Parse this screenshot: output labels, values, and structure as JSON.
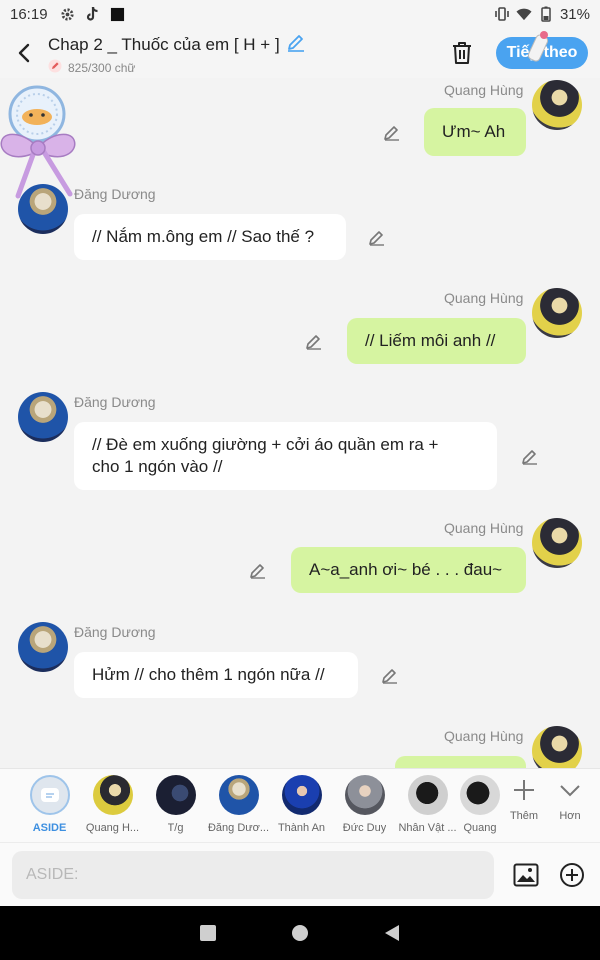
{
  "status_bar": {
    "time": "16:19",
    "battery": "31%",
    "left_icons": [
      "gear-icon",
      "tiktok-icon",
      "square-icon"
    ],
    "right_icons": [
      "vibrate-icon",
      "wifi-icon",
      "battery-icon"
    ]
  },
  "header": {
    "title": "Chap 2 _ Thuốc của em [ H + ]",
    "word_count": "825/300 chữ",
    "next_label": "Tiếp theo",
    "accent": "#4aa3f0"
  },
  "messages": [
    {
      "side": "right",
      "name": "",
      "text": "Ưm~ Ah"
    },
    {
      "side": "left",
      "name": "Đăng Dương",
      "text": "// Nắm m.ông em // Sao thế ?"
    },
    {
      "side": "right",
      "name": "Quang Hùng",
      "text": "// Liếm môi anh //"
    },
    {
      "side": "left",
      "name": "Đăng Dương",
      "text": "// Đè em xuống giường + cởi áo quần em ra +",
      "text2": "cho 1 ngón vào //"
    },
    {
      "side": "right",
      "name": "Quang Hùng",
      "text": "A~a_anh ơi~ bé . . . đau~"
    },
    {
      "side": "left",
      "name": "Đăng Dương",
      "text": "Hửm // cho thêm 1 ngón nữa //"
    },
    {
      "side": "right",
      "name": "Quang Hùng",
      "text": ""
    }
  ],
  "top_name": "Quang Hùng",
  "characters": [
    {
      "label": "ASIDE",
      "active": true
    },
    {
      "label": "Quang H..."
    },
    {
      "label": "T/g"
    },
    {
      "label": "Đăng Dươ..."
    },
    {
      "label": "Thành An"
    },
    {
      "label": "Đức Duy"
    },
    {
      "label": "Nhân Vật ..."
    },
    {
      "label": "Quang"
    }
  ],
  "tools": {
    "more_label": "Thêm",
    "less_label": "Hơn"
  },
  "input": {
    "placeholder": "ASIDE:"
  },
  "colors": {
    "green_bubble": "#d6f4a1",
    "white_bubble": "#ffffff",
    "background": "#f3f3f3"
  }
}
